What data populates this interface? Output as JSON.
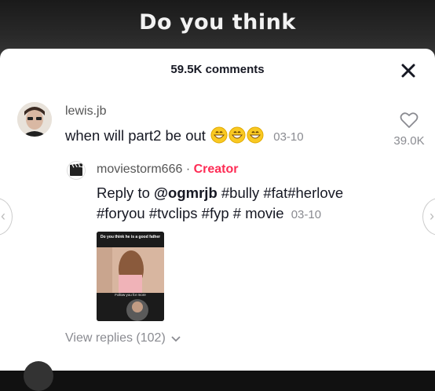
{
  "video": {
    "title_visible": "Do you think"
  },
  "sheet": {
    "header": "59.5K comments",
    "close_icon": "close-icon"
  },
  "comment": {
    "username": "lewis.jb",
    "text": "when will part2 be out",
    "emojis": [
      "grinning-emoji",
      "grinning-emoji",
      "grinning-emoji"
    ],
    "date": "03-10",
    "likes": "39.0K"
  },
  "reply": {
    "username": "moviestorm666",
    "separator": " · ",
    "badge": "Creator",
    "prefix": "Reply to ",
    "mention": "@ogmrjb",
    "text": " #bully #fat#herlove #foryou #tvclips #fyp # movie",
    "date": "03-10",
    "thumbnail": {
      "caption_top": "Do you think he is a good father",
      "caption_bottom": "Follow you for more"
    }
  },
  "view_replies": "View replies (102)",
  "colors": {
    "accent": "#fe2c55",
    "muted": "#8a8b91",
    "text": "#161823"
  }
}
